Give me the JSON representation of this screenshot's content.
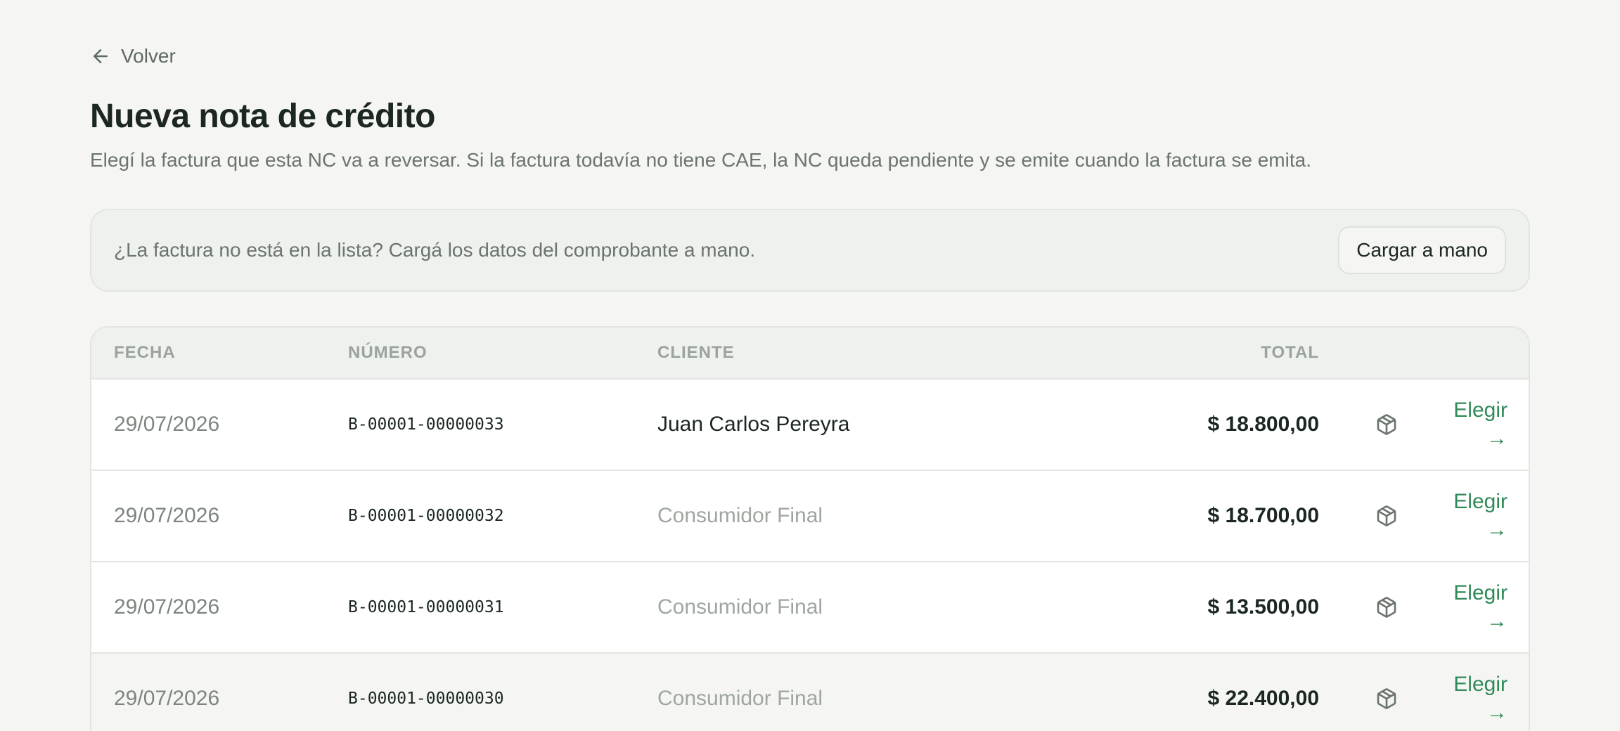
{
  "nav": {
    "back_label": "Volver"
  },
  "header": {
    "title": "Nueva nota de crédito",
    "subtitle": "Elegí la factura que esta NC va a reversar. Si la factura todavía no tiene CAE, la NC queda pendiente y se emite cuando la factura se emita."
  },
  "notice": {
    "text": "¿La factura no está en la lista? Cargá los datos del comprobante a mano.",
    "button_label": "Cargar a mano"
  },
  "table": {
    "columns": {
      "fecha": "FECHA",
      "numero": "NÚMERO",
      "cliente": "CLIENTE",
      "total": "TOTAL"
    },
    "choose_label": "Elegir",
    "choose_arrow": "→",
    "rows": [
      {
        "fecha": "29/07/2026",
        "numero": "B-00001-00000033",
        "cliente": "Juan Carlos Pereyra",
        "total": "$ 18.800,00"
      },
      {
        "fecha": "29/07/2026",
        "numero": "B-00001-00000032",
        "cliente": "Consumidor Final",
        "total": "$ 18.700,00"
      },
      {
        "fecha": "29/07/2026",
        "numero": "B-00001-00000031",
        "cliente": "Consumidor Final",
        "total": "$ 13.500,00"
      },
      {
        "fecha": "29/07/2026",
        "numero": "B-00001-00000030",
        "cliente": "Consumidor Final",
        "total": "$ 22.400,00"
      }
    ]
  },
  "icons": {
    "back": "arrow-left-icon",
    "row_action": "package-icon"
  },
  "colors": {
    "accent": "#2f8a57",
    "background": "#f5f6f3",
    "text": "#1b2720",
    "muted": "#9ea6a0"
  }
}
